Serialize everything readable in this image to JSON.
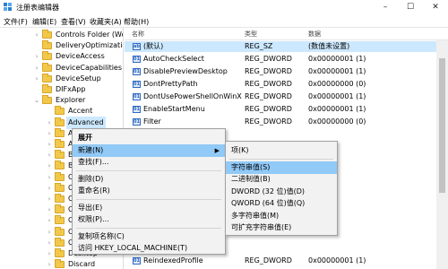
{
  "window": {
    "title": "注册表编辑器",
    "controls": {
      "minimize": "–",
      "maximize": "☐",
      "close": "✕"
    }
  },
  "menu": [
    "文件(F)",
    "编辑(E)",
    "查看(V)",
    "收藏夹(A)",
    "帮助(H)"
  ],
  "tree": [
    {
      "label": "Controls Folder (Wo",
      "arrow": "›"
    },
    {
      "label": "DeliveryOptimization",
      "arrow": ""
    },
    {
      "label": "DeviceAccess",
      "arrow": "›"
    },
    {
      "label": "DeviceCapabilities",
      "arrow": "›"
    },
    {
      "label": "DeviceSetup",
      "arrow": "›"
    },
    {
      "label": "DIFxApp",
      "arrow": ""
    },
    {
      "label": "Explorer",
      "arrow": "⌄"
    },
    {
      "label": "Accent",
      "arrow": ""
    },
    {
      "label": "Advanced",
      "arrow": "›",
      "selected": true
    },
    {
      "label": "AppCo",
      "arrow": "›"
    },
    {
      "label": "Autopl",
      "arrow": "›"
    },
    {
      "label": "Banner",
      "arrow": "›"
    },
    {
      "label": "BitBuck",
      "arrow": "›"
    },
    {
      "label": "Cabine",
      "arrow": "›"
    },
    {
      "label": "CD Bur",
      "arrow": "›"
    },
    {
      "label": "CIDOp",
      "arrow": "›"
    },
    {
      "label": "CIDSav",
      "arrow": "›"
    },
    {
      "label": "CLSID",
      "arrow": "›"
    },
    {
      "label": "ComDl",
      "arrow": "›"
    },
    {
      "label": "Contro",
      "arrow": "›"
    },
    {
      "label": "Desktop",
      "arrow": "›"
    },
    {
      "label": "Discard",
      "arrow": "›"
    }
  ],
  "list": {
    "headers": {
      "name": "名称",
      "type": "类型",
      "data": "数据"
    },
    "rows": [
      {
        "icon": "ab",
        "name": "(默认)",
        "type": "REG_SZ",
        "data": "(数值未设置)",
        "selected": true
      },
      {
        "icon": "011",
        "name": "AutoCheckSelect",
        "type": "REG_DWORD",
        "data": "0x00000001 (1)"
      },
      {
        "icon": "011",
        "name": "DisablePreviewDesktop",
        "type": "REG_DWORD",
        "data": "0x00000001 (1)"
      },
      {
        "icon": "011",
        "name": "DontPrettyPath",
        "type": "REG_DWORD",
        "data": "0x00000000 (0)"
      },
      {
        "icon": "011",
        "name": "DontUsePowerShellOnWinX",
        "type": "REG_DWORD",
        "data": "0x00000001 (1)"
      },
      {
        "icon": "011",
        "name": "EnableStartMenu",
        "type": "REG_DWORD",
        "data": "0x00000001 (1)"
      },
      {
        "icon": "011",
        "name": "Filter",
        "type": "REG_DWORD",
        "data": "0x00000000 (0)"
      },
      {
        "icon": "011",
        "name": "ReindexedProfile",
        "type": "REG_DWORD",
        "data": "0x00000001 (1)"
      }
    ]
  },
  "context_menu": [
    {
      "label": "展开",
      "bold": true
    },
    {
      "label": "新建(N)",
      "submenu": true,
      "highlight": true
    },
    {
      "label": "查找(F)..."
    },
    {
      "separator": true
    },
    {
      "label": "删除(D)"
    },
    {
      "label": "重命名(R)"
    },
    {
      "separator": true
    },
    {
      "label": "导出(E)"
    },
    {
      "label": "权限(P)..."
    },
    {
      "separator": true
    },
    {
      "label": "复制项名称(C)"
    },
    {
      "label": "访问 HKEY_LOCAL_MACHINE(T)"
    }
  ],
  "submenu": [
    {
      "label": "项(K)"
    },
    {
      "separator": true
    },
    {
      "label": "字符串值(S)",
      "highlight": true
    },
    {
      "label": "二进制值(B)"
    },
    {
      "label": "DWORD (32 位)值(D)"
    },
    {
      "label": "QWORD (64 位)值(Q)"
    },
    {
      "label": "多字符串值(M)"
    },
    {
      "label": "可扩充字符串值(E)"
    }
  ],
  "colors": {
    "selection": "#cce8ff",
    "menu_highlight": "#91c9f7",
    "folder": "#f2c84b"
  }
}
